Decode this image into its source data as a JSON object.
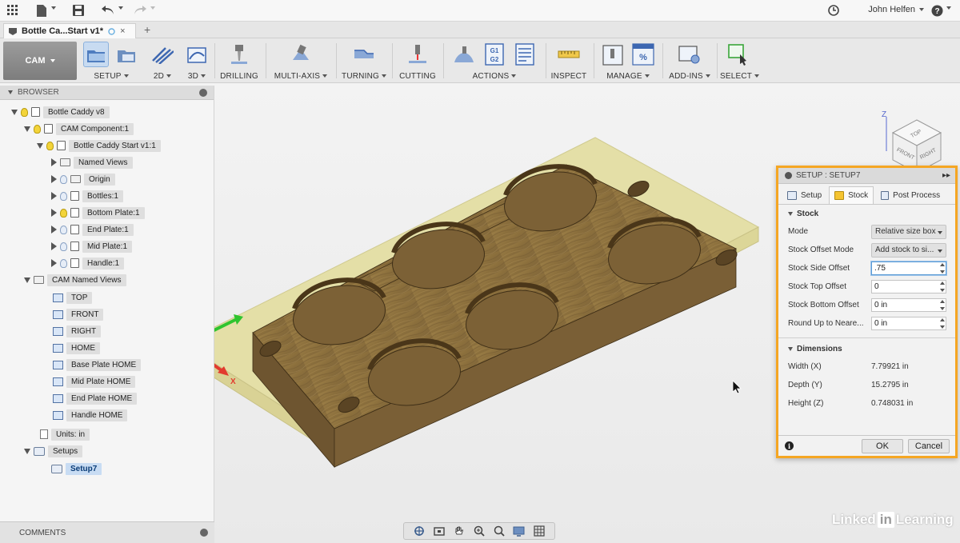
{
  "window": {
    "user": "John Helfen"
  },
  "document_tab": {
    "title": "Bottle Ca...Start v1*",
    "add_tab": "+"
  },
  "ribbon": {
    "workspace": "CAM",
    "groups": [
      {
        "label": "SETUP",
        "dropdown": true
      },
      {
        "label": "2D",
        "dropdown": true
      },
      {
        "label": "3D",
        "dropdown": true
      },
      {
        "label": "DRILLING",
        "dropdown": false
      },
      {
        "label": "MULTI-AXIS",
        "dropdown": true
      },
      {
        "label": "TURNING",
        "dropdown": true
      },
      {
        "label": "CUTTING",
        "dropdown": false
      },
      {
        "label": "ACTIONS",
        "dropdown": true
      },
      {
        "label": "INSPECT",
        "dropdown": false
      },
      {
        "label": "MANAGE",
        "dropdown": true
      },
      {
        "label": "ADD-INS",
        "dropdown": true
      },
      {
        "label": "SELECT",
        "dropdown": false
      }
    ],
    "gcode_icon_text": [
      "G1",
      "G2"
    ]
  },
  "browser": {
    "title": "BROWSER",
    "tree": [
      {
        "label": "Bottle Caddy v8"
      },
      {
        "label": "CAM Component:1"
      },
      {
        "label": "Bottle Caddy Start v1:1"
      },
      {
        "label": "Named Views"
      },
      {
        "label": "Origin"
      },
      {
        "label": "Bottles:1"
      },
      {
        "label": "Bottom Plate:1"
      },
      {
        "label": "End Plate:1"
      },
      {
        "label": "Mid Plate:1"
      },
      {
        "label": "Handle:1"
      },
      {
        "label": "CAM Named Views"
      },
      {
        "label": "TOP"
      },
      {
        "label": "FRONT"
      },
      {
        "label": "RIGHT"
      },
      {
        "label": "HOME"
      },
      {
        "label": "Base Plate HOME"
      },
      {
        "label": "Mid Plate HOME"
      },
      {
        "label": "End Plate HOME"
      },
      {
        "label": "Handle HOME"
      },
      {
        "label": "Units: in"
      },
      {
        "label": "Setups"
      },
      {
        "label": "Setup7"
      }
    ]
  },
  "comments": {
    "title": "COMMENTS"
  },
  "viewport": {
    "axes": {
      "z": "Z",
      "x": "X"
    },
    "viewcube": {
      "z": "Z",
      "top": "TOP",
      "front": "FRONT",
      "right": "RIGHT",
      "x": "X"
    }
  },
  "setup_dialog": {
    "title": "SETUP : SETUP7",
    "tabs": [
      "Setup",
      "Stock",
      "Post Process"
    ],
    "stock_section": "Stock",
    "fields": [
      {
        "label": "Mode",
        "type": "select",
        "value": "Relative size box"
      },
      {
        "label": "Stock Offset Mode",
        "type": "select",
        "value": "Add stock to si..."
      },
      {
        "label": "Stock Side Offset",
        "type": "input",
        "value": ".75",
        "focused": true
      },
      {
        "label": "Stock Top Offset",
        "type": "input",
        "value": "0"
      },
      {
        "label": "Stock Bottom Offset",
        "type": "input",
        "value": "0 in"
      },
      {
        "label": "Round Up to Neare...",
        "type": "input",
        "value": "0 in"
      }
    ],
    "dimensions_section": "Dimensions",
    "dimensions": [
      {
        "label": "Width (X)",
        "value": "7.79921 in"
      },
      {
        "label": "Depth (Y)",
        "value": "15.2795 in"
      },
      {
        "label": "Height (Z)",
        "value": "0.748031 in"
      }
    ],
    "ok": "OK",
    "cancel": "Cancel"
  },
  "watermark": {
    "brand_left": "Linked",
    "brand_in": "in",
    "brand_right": "Learning"
  },
  "colors": {
    "dialog_border": "#f5a623",
    "wood": "#8e7440",
    "stock_box": "#e8e2a8",
    "axis_z": "#2233cc",
    "axis_y": "#2fc42f",
    "axis_x": "#e23b2e"
  }
}
